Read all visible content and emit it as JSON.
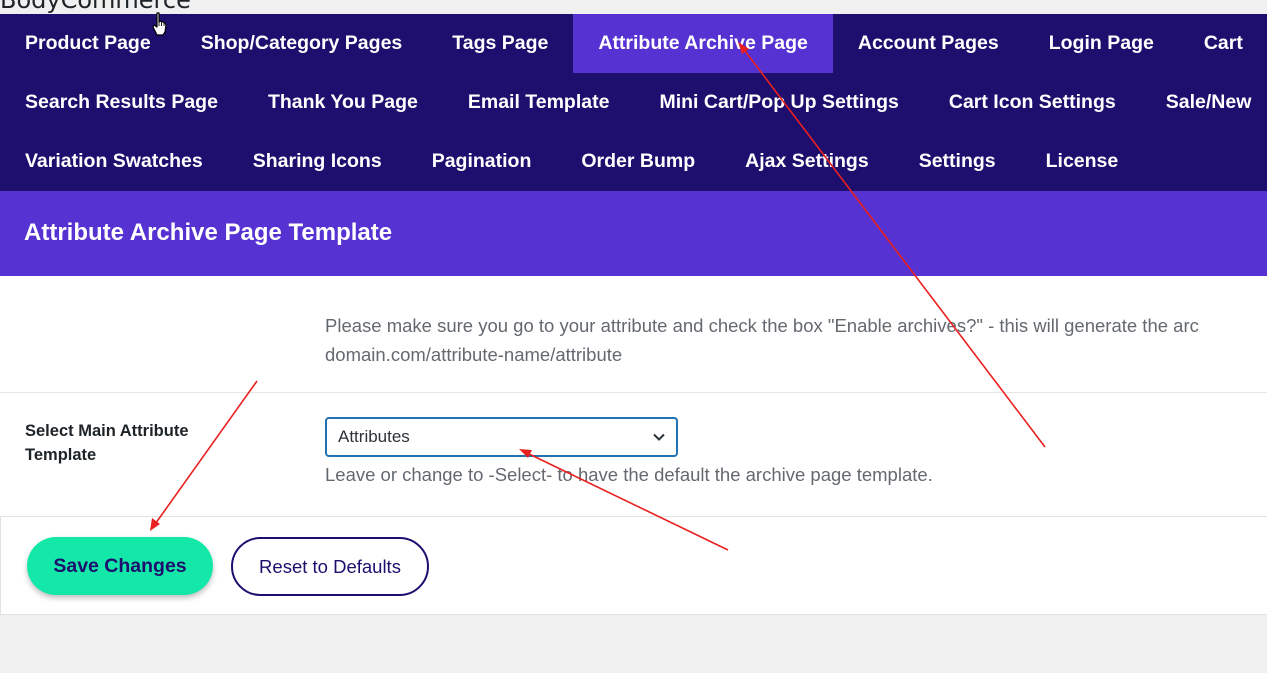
{
  "brand": {
    "text": "BodyCommerce"
  },
  "nav": {
    "row1": [
      {
        "label": "Product Page",
        "active": false
      },
      {
        "label": "Shop/Category Pages",
        "active": false
      },
      {
        "label": "Tags Page",
        "active": false
      },
      {
        "label": "Attribute Archive Page",
        "active": true
      },
      {
        "label": "Account Pages",
        "active": false
      },
      {
        "label": "Login Page",
        "active": false
      },
      {
        "label": "Cart",
        "active": false
      }
    ],
    "row2": [
      {
        "label": "Search Results Page"
      },
      {
        "label": "Thank You Page"
      },
      {
        "label": "Email Template"
      },
      {
        "label": "Mini Cart/Pop Up Settings"
      },
      {
        "label": "Cart Icon Settings"
      },
      {
        "label": "Sale/New"
      }
    ],
    "row3": [
      {
        "label": "Variation Swatches"
      },
      {
        "label": "Sharing Icons"
      },
      {
        "label": "Pagination"
      },
      {
        "label": "Order Bump"
      },
      {
        "label": "Ajax Settings"
      },
      {
        "label": "Settings"
      },
      {
        "label": "License"
      }
    ]
  },
  "header": {
    "title": "Attribute Archive Page Template"
  },
  "content": {
    "notice_line1": "Please make sure you go to your attribute and check the box \"Enable archives?\" - this will generate the arc",
    "notice_line2": "domain.com/attribute-name/attribute",
    "field_label": "Select Main Attribute Template",
    "select_value": "Attributes",
    "help_text": "Leave or change to -Select- to have the default the archive page template."
  },
  "footer": {
    "save_label": "Save Changes",
    "reset_label": "Reset to Defaults"
  },
  "colors": {
    "nav_bg": "#1e0f6e",
    "accent": "#5532d1",
    "save_bg": "#13e8a9",
    "annotation_arrow": "#e8201f"
  }
}
